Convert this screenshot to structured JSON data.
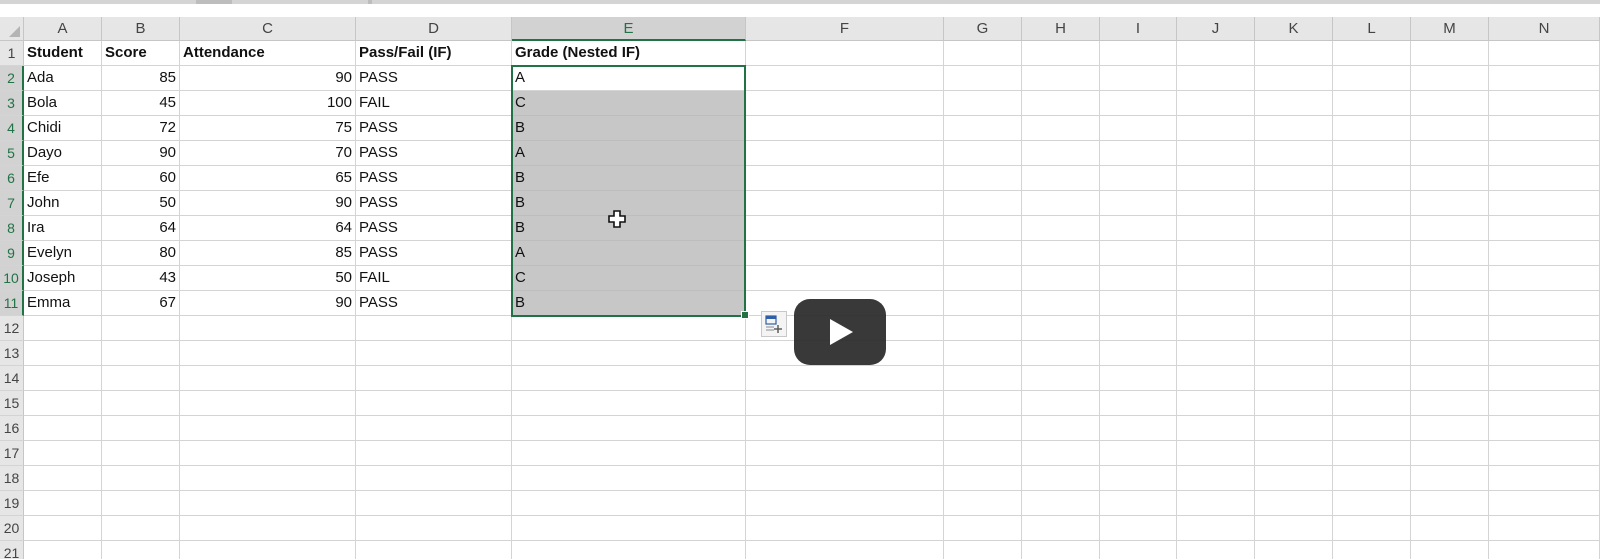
{
  "columns": [
    "A",
    "B",
    "C",
    "D",
    "E",
    "F",
    "G",
    "H",
    "I",
    "J",
    "K",
    "L",
    "M",
    "N"
  ],
  "rows": [
    "1",
    "2",
    "3",
    "4",
    "5",
    "6",
    "7",
    "8",
    "9",
    "10",
    "11",
    "12",
    "13",
    "14",
    "15",
    "16",
    "17",
    "18",
    "19",
    "20",
    "21"
  ],
  "selected_column": "E",
  "selected_range": "E2:E11",
  "table": {
    "headers": [
      "Student",
      "Score",
      "Attendance",
      "Pass/Fail (IF)",
      "Grade (Nested IF)"
    ],
    "records": [
      [
        "Ada",
        "85",
        "90",
        "PASS",
        "A"
      ],
      [
        "Bola",
        "45",
        "100",
        "FAIL",
        "C"
      ],
      [
        "Chidi",
        "72",
        "75",
        "PASS",
        "B"
      ],
      [
        "Dayo",
        "90",
        "70",
        "PASS",
        "A"
      ],
      [
        "Efe",
        "60",
        "65",
        "PASS",
        "B"
      ],
      [
        "John",
        "50",
        "90",
        "PASS",
        "B"
      ],
      [
        "Ira",
        "64",
        "64",
        "PASS",
        "B"
      ],
      [
        "Evelyn",
        "80",
        "85",
        "PASS",
        "A"
      ],
      [
        "Joseph",
        "43",
        "50",
        "FAIL",
        "C"
      ],
      [
        "Emma",
        "67",
        "90",
        "PASS",
        "B"
      ]
    ]
  },
  "icons": {
    "select_all": "select-all-triangle-icon",
    "fill_handle": "fill-handle-icon",
    "quick_analysis": "quick-analysis-icon",
    "cursor": "cell-select-cross-cursor-icon",
    "video_play": "play-icon"
  },
  "colors": {
    "accent": "#217346",
    "selection_fill": "#c7c7c7",
    "header_bg": "#e6e6e6",
    "gridline": "#d4d4d4",
    "play_button": "#2b2b2b"
  }
}
